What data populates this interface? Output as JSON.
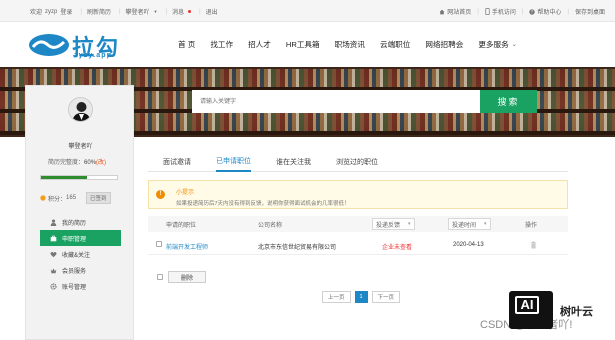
{
  "topbar": {
    "welcome": "欢迎",
    "username": "zyzp",
    "login": "登录",
    "recent": "刷新简历",
    "user_menu": "攀登者吖",
    "messages": "消息",
    "logout": "退出",
    "right": {
      "home": "网站首页",
      "mobile": "手机访问",
      "help": "帮助中心",
      "favorite": "保存到桌面"
    }
  },
  "logo": {
    "cn": "拉勾",
    "en": "zyzy.app"
  },
  "nav": {
    "items": [
      "首 页",
      "找工作",
      "招人才",
      "HR工具箱",
      "职场资讯",
      "云端职位",
      "网络招聘会"
    ],
    "more": "更多服务"
  },
  "search": {
    "placeholder": "请输入关键字",
    "button": "搜索"
  },
  "sidebar": {
    "username": "攀登者吖",
    "completeness_label": "简历完整度：",
    "completeness_value": "60%",
    "edit_label": "(改)",
    "progress": 0.6,
    "points_label": "积分：",
    "points_value": "165",
    "signed": "已签到",
    "menu": [
      {
        "label": "我的简历",
        "icon": "user-icon"
      },
      {
        "label": "申职管理",
        "icon": "briefcase-icon",
        "active": true
      },
      {
        "label": "收藏&关注",
        "icon": "heart-icon"
      },
      {
        "label": "会员服务",
        "icon": "vip-icon"
      },
      {
        "label": "账号管理",
        "icon": "gear-icon"
      }
    ]
  },
  "tabs": [
    "面试邀请",
    "已申请职位",
    "谁在关注我",
    "浏览过的职位"
  ],
  "tip": {
    "title": "小提示",
    "text": "如果投递简历后7天内没有得到反馈，说明你获得面试机会的几率很低！"
  },
  "table": {
    "headers": {
      "job": "申请的职位",
      "company": "公司名称",
      "time_filter": "投递时间",
      "action": "操作"
    },
    "status_filter": "投递反馈",
    "rows": [
      {
        "job": "前端开发工程师",
        "company": "北京市东信世纪贸易有限公司",
        "status": "企业未查看",
        "date": "2020-04-13"
      }
    ],
    "delete_button": "删除"
  },
  "pager": {
    "prev": "上一页",
    "current": "1",
    "next": "下一页"
  },
  "watermark": {
    "ai": "AI",
    "brand": "树叶云",
    "csdn": "CSDN @攀登者吖!"
  },
  "colors": {
    "green": "#1aa262",
    "blue": "#1e88c7",
    "orange": "#f08c00",
    "red": "#e33333"
  }
}
